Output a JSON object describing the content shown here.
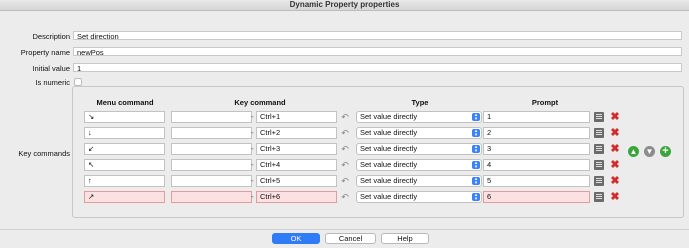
{
  "window": {
    "title": "Dynamic Property properties"
  },
  "form": {
    "description": {
      "label": "Description",
      "value": "Set direction"
    },
    "property_name": {
      "label": "Property name",
      "value": "newPos"
    },
    "initial_value": {
      "label": "Initial value",
      "value": "1"
    },
    "is_numeric": {
      "label": "Is numeric",
      "checked": false
    }
  },
  "key_commands": {
    "label": "Key commands",
    "headers": {
      "menu_command": "Menu command",
      "key_command": "Key command",
      "type": "Type",
      "prompt": "Prompt"
    },
    "rows": [
      {
        "menu": "↘",
        "key_left": "",
        "dash": "-",
        "key": "Ctrl+1",
        "type": "Set value directly",
        "prompt": "1",
        "error": false
      },
      {
        "menu": "↓",
        "key_left": "",
        "dash": "-",
        "key": "Ctrl+2",
        "type": "Set value directly",
        "prompt": "2",
        "error": false
      },
      {
        "menu": "↙",
        "key_left": "",
        "dash": "-",
        "key": "Ctrl+3",
        "type": "Set value directly",
        "prompt": "3",
        "error": false
      },
      {
        "menu": "↖",
        "key_left": "",
        "dash": "-",
        "key": "Ctrl+4",
        "type": "Set value directly",
        "prompt": "4",
        "error": false
      },
      {
        "menu": "↑",
        "key_left": "",
        "dash": "-",
        "key": "Ctrl+5",
        "type": "Set value directly",
        "prompt": "5",
        "error": false
      },
      {
        "menu": "↗",
        "key_left": "",
        "dash": "-",
        "key": "Ctrl+6",
        "type": "Set value directly",
        "prompt": "6",
        "error": true
      }
    ],
    "side_icons": [
      "move-up-icon",
      "move-down-icon",
      "add-icon"
    ]
  },
  "buttons": {
    "ok": "OK",
    "cancel": "Cancel",
    "help": "Help"
  },
  "colors": {
    "primary": "#2f7cf6",
    "error_bg": "#fbe1e1",
    "delete": "#d62b2b",
    "add": "#3aa53a"
  }
}
